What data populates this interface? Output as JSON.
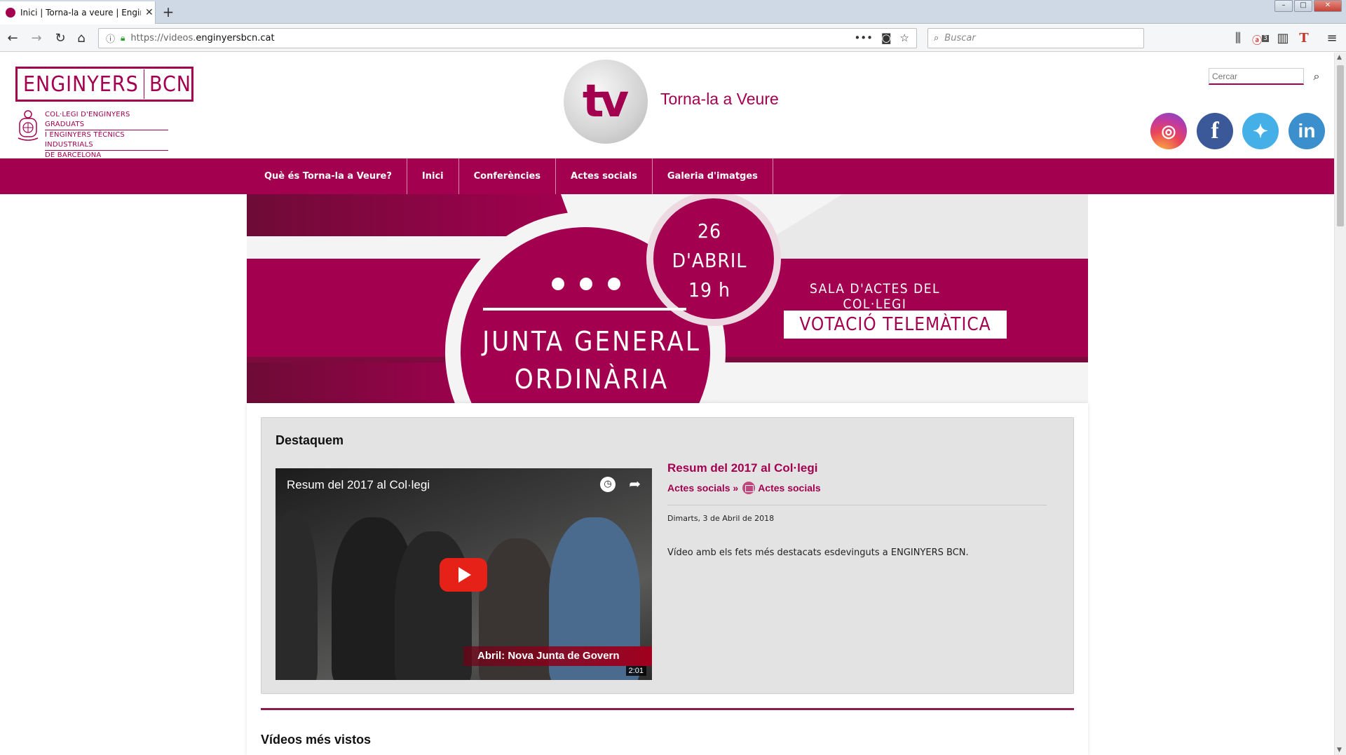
{
  "browser": {
    "tab_title": "Inici | Torna-la a veure | Enginy",
    "tab_close": "✕",
    "new_tab": "+",
    "url_prefix": "https://videos.",
    "url_domain": "enginyersbcn.cat",
    "search_placeholder": "Buscar",
    "ublock_badge": "3"
  },
  "header": {
    "logo_left": "ENGINYERS",
    "logo_right": "BCN",
    "college_lines": [
      "COL·LEGI D'ENGINYERS GRADUATS",
      "I ENGINYERS TÈCNICS INDUSTRIALS",
      "DE BARCELONA"
    ],
    "tv_logo": "tv",
    "site_title": "Torna-la a Veure",
    "search_placeholder": "Cercar"
  },
  "social": {
    "instagram": "◎",
    "facebook": "f",
    "twitter": "✦",
    "linkedin": "in"
  },
  "menu": {
    "items": [
      "Què és Torna-la a Veure?",
      "Inici",
      "Conferències",
      "Actes socials",
      "Galeria d'imatges"
    ]
  },
  "banner": {
    "date_day": "26",
    "date_month": "D'ABRIL",
    "date_time": "19 h",
    "title_line1": "JUNTA GENERAL",
    "title_line2": "ORDINÀRIA",
    "location": "SALA D'ACTES DEL COL·LEGI",
    "voting": "VOTACIÓ TELEMÀTICA"
  },
  "featured": {
    "heading": "Destaquem",
    "video": {
      "title": "Resum del 2017 al Col·legi",
      "lower_third": "Abril: Nova Junta de Govern",
      "duration": "2:01"
    },
    "item_title": "Resum del 2017 al Col·legi",
    "category_parent": "Actes socials",
    "category_separator": "»",
    "category_child": "Actes socials",
    "date": "Dimarts, 3 de Abril de 2018",
    "description": "Vídeo amb els fets més destacats esdevinguts a ENGINYERS BCN."
  },
  "most_viewed": {
    "heading": "Vídeos més vistos"
  },
  "colors": {
    "brand": "#a30050",
    "brand_dark": "#7c0a3d",
    "banner_band": "#a30050"
  }
}
